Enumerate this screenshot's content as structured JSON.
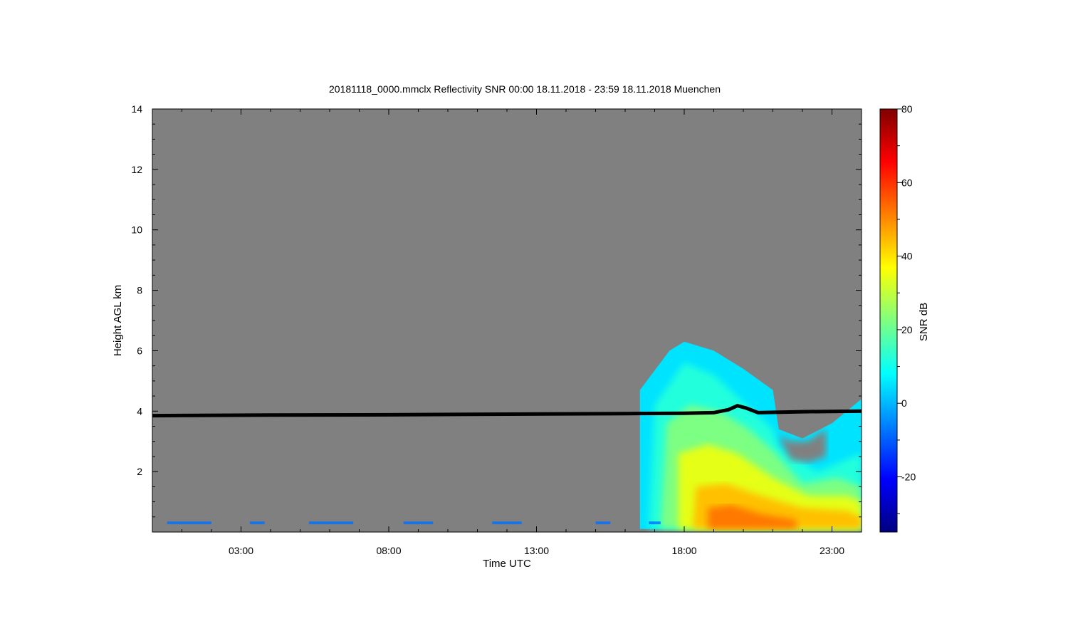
{
  "chart_data": {
    "type": "heatmap",
    "title": "20181118_0000.mmclx Reflectivity SNR   00:00 18.11.2018 - 23:59 18.11.2018 Muenchen",
    "xlabel": "Time UTC",
    "ylabel": "Height AGL km",
    "xlim": [
      0,
      24
    ],
    "ylim": [
      0,
      14
    ],
    "x_ticks": [
      {
        "value": 3,
        "label": "03:00"
      },
      {
        "value": 8,
        "label": "08:00"
      },
      {
        "value": 13,
        "label": "13:00"
      },
      {
        "value": 18,
        "label": "18:00"
      },
      {
        "value": 23,
        "label": "23:00"
      }
    ],
    "y_ticks": [
      {
        "value": 2,
        "label": "2"
      },
      {
        "value": 4,
        "label": "4"
      },
      {
        "value": 6,
        "label": "6"
      },
      {
        "value": 8,
        "label": "8"
      },
      {
        "value": 10,
        "label": "10"
      },
      {
        "value": 12,
        "label": "12"
      },
      {
        "value": 14,
        "label": "14"
      }
    ],
    "background_color": "#808080",
    "colorbar": {
      "label": "SNR dB",
      "range": [
        -35,
        80
      ],
      "ticks": [
        {
          "value": -20,
          "label": "-20"
        },
        {
          "value": 0,
          "label": "0"
        },
        {
          "value": 20,
          "label": "20"
        },
        {
          "value": 40,
          "label": "40"
        },
        {
          "value": 60,
          "label": "60"
        },
        {
          "value": 80,
          "label": "80"
        }
      ],
      "colormap": [
        "#00007f",
        "#0000ff",
        "#007fff",
        "#00ffff",
        "#7fff7f",
        "#ffff00",
        "#ff7f00",
        "#ff0000",
        "#7f0000"
      ]
    },
    "reference_line": {
      "name": "black trace",
      "color": "#000000",
      "points": [
        [
          0,
          3.85
        ],
        [
          4,
          3.87
        ],
        [
          8,
          3.88
        ],
        [
          12,
          3.9
        ],
        [
          16,
          3.92
        ],
        [
          18,
          3.93
        ],
        [
          19,
          3.95
        ],
        [
          19.5,
          4.05
        ],
        [
          19.8,
          4.18
        ],
        [
          20.1,
          4.1
        ],
        [
          20.5,
          3.95
        ],
        [
          22,
          3.98
        ],
        [
          24,
          4.0
        ]
      ]
    },
    "echo_region": {
      "time_range": [
        16.5,
        24
      ],
      "top_boundary": [
        [
          16.5,
          4.7
        ],
        [
          16.8,
          5.0
        ],
        [
          17.2,
          5.5
        ],
        [
          17.5,
          6.0
        ],
        [
          17.8,
          6.1
        ],
        [
          18.0,
          6.3
        ],
        [
          18.5,
          6.2
        ],
        [
          19.0,
          6.0
        ],
        [
          19.5,
          5.7
        ],
        [
          20.0,
          5.4
        ],
        [
          20.5,
          5.1
        ],
        [
          21.0,
          4.7
        ],
        [
          21.2,
          4.4
        ],
        [
          21.2,
          3.4
        ],
        [
          21.6,
          3.2
        ],
        [
          22.0,
          3.1
        ],
        [
          22.4,
          3.2
        ],
        [
          22.8,
          3.5
        ],
        [
          23.2,
          3.9
        ],
        [
          23.6,
          4.0
        ],
        [
          24.0,
          4.4
        ]
      ],
      "clear_pocket": [
        [
          21.2,
          3.2
        ],
        [
          21.6,
          2.4
        ],
        [
          22.2,
          2.3
        ],
        [
          22.8,
          2.5
        ],
        [
          22.8,
          3.4
        ],
        [
          22.2,
          3.0
        ],
        [
          21.6,
          3.0
        ]
      ],
      "layers": [
        {
          "snr": 5,
          "shape": [
            [
              16.5,
              4.7
            ],
            [
              17.5,
              6.0
            ],
            [
              18.0,
              6.3
            ],
            [
              19.0,
              6.0
            ],
            [
              20.0,
              5.4
            ],
            [
              21.0,
              4.7
            ],
            [
              21.2,
              3.4
            ],
            [
              22.0,
              3.1
            ],
            [
              23.0,
              3.6
            ],
            [
              24.0,
              4.4
            ],
            [
              24.0,
              0.1
            ],
            [
              16.5,
              0.1
            ]
          ]
        },
        {
          "snr": 12,
          "shape": [
            [
              17.0,
              4.2
            ],
            [
              18.0,
              5.6
            ],
            [
              19.0,
              5.2
            ],
            [
              20.0,
              4.3
            ],
            [
              21.0,
              3.4
            ],
            [
              21.2,
              2.8
            ],
            [
              22.5,
              2.0
            ],
            [
              24.0,
              2.6
            ],
            [
              24.0,
              0.1
            ],
            [
              16.8,
              0.1
            ]
          ]
        },
        {
          "snr": 22,
          "shape": [
            [
              17.4,
              3.6
            ],
            [
              18.2,
              4.2
            ],
            [
              19.2,
              4.0
            ],
            [
              20.2,
              3.4
            ],
            [
              21.0,
              2.7
            ],
            [
              22.0,
              1.6
            ],
            [
              23.2,
              1.8
            ],
            [
              24.0,
              1.5
            ],
            [
              24.0,
              0.1
            ],
            [
              17.2,
              0.1
            ]
          ]
        },
        {
          "snr": 34,
          "shape": [
            [
              17.8,
              2.6
            ],
            [
              18.8,
              2.9
            ],
            [
              19.8,
              2.6
            ],
            [
              21.0,
              1.8
            ],
            [
              22.2,
              1.2
            ],
            [
              23.5,
              1.2
            ],
            [
              24.0,
              1.0
            ],
            [
              24.0,
              0.1
            ],
            [
              17.8,
              0.1
            ]
          ]
        },
        {
          "snr": 44,
          "shape": [
            [
              18.4,
              1.5
            ],
            [
              19.4,
              1.6
            ],
            [
              20.6,
              1.2
            ],
            [
              22.0,
              0.8
            ],
            [
              23.5,
              0.7
            ],
            [
              24.0,
              0.5
            ],
            [
              24.0,
              0.1
            ],
            [
              18.3,
              0.1
            ]
          ]
        },
        {
          "snr": 52,
          "shape": [
            [
              18.8,
              0.8
            ],
            [
              19.6,
              0.9
            ],
            [
              20.6,
              0.6
            ],
            [
              21.8,
              0.4
            ],
            [
              21.8,
              0.1
            ],
            [
              18.8,
              0.1
            ]
          ]
        }
      ],
      "near_surface_clutter_snr": -8,
      "near_surface_clutter_time": [
        [
          0.5,
          2.0
        ],
        [
          3.3,
          3.8
        ],
        [
          5.3,
          6.8
        ],
        [
          8.5,
          9.5
        ],
        [
          11.5,
          12.5
        ],
        [
          15.0,
          15.5
        ],
        [
          16.8,
          17.2
        ]
      ]
    }
  }
}
